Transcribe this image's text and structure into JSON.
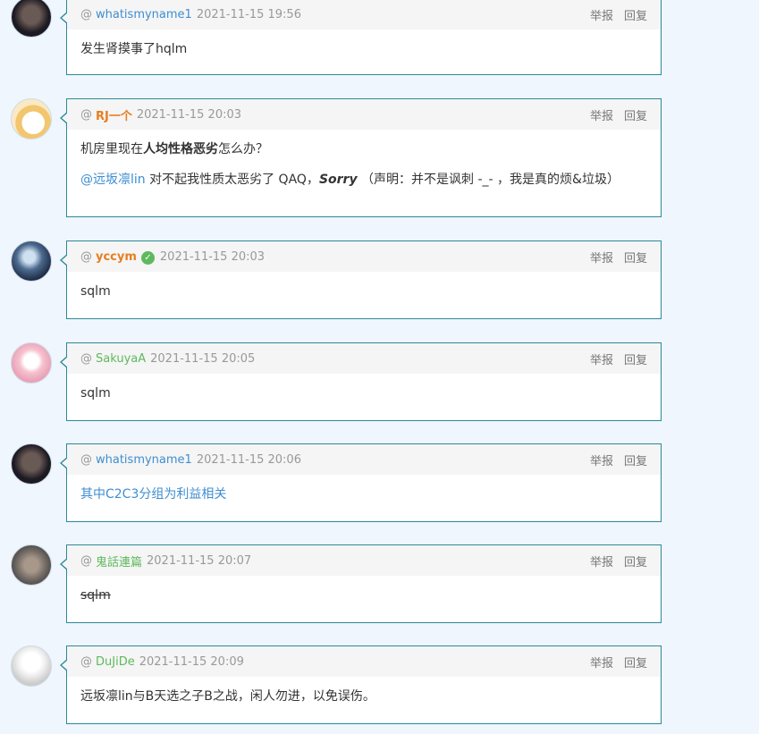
{
  "actions": {
    "report": "举报",
    "reply": "回复"
  },
  "at": "@",
  "comments": [
    {
      "user": "whatismyname1",
      "time": "2021-11-15 19:56",
      "lines": [
        "发生肾摸事了hqlm"
      ]
    },
    {
      "user": "RJ一个",
      "time": "2021-11-15 20:03",
      "line1_pre": "机房里现在",
      "line1_bold": "人均性格恶劣",
      "line1_post": "怎么办？",
      "line2_mention": "@远坂凛lin",
      "line2_mid": " 对不起我性质太恶劣了 QAQ，",
      "line2_bold": "Sorry",
      "line2_post": " （声明：并不是讽刺 -_- ，我是真的烦&垃圾）"
    },
    {
      "user": "yccym",
      "verified_icon": "check-badge-icon",
      "time": "2021-11-15 20:03",
      "lines": [
        "sqlm"
      ]
    },
    {
      "user": "SakuyaA",
      "time": "2021-11-15 20:05",
      "lines": [
        "sqlm"
      ]
    },
    {
      "user": "whatismyname1",
      "time": "2021-11-15 20:06",
      "lines": [
        "其中C2C3分组为利益相关"
      ]
    },
    {
      "user": "鬼話連篇",
      "time": "2021-11-15 20:07",
      "lines": [
        "sqlm"
      ]
    },
    {
      "user": "DuJiDe",
      "time": "2021-11-15 20:09",
      "lines": [
        "远坂凛lin与B天选之子B之战，闲人勿进，以免误伤。"
      ]
    }
  ]
}
